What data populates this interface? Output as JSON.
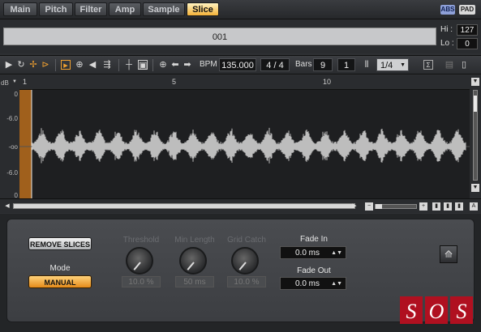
{
  "tabs": [
    {
      "label": "Main",
      "active": false
    },
    {
      "label": "Pitch",
      "active": false
    },
    {
      "label": "Filter",
      "active": false
    },
    {
      "label": "Amp",
      "active": false
    },
    {
      "label": "Sample",
      "active": false
    },
    {
      "label": "Slice",
      "active": true
    }
  ],
  "header_badges": {
    "abs": "ABS",
    "pad": "PAD"
  },
  "slice": {
    "name": "001",
    "hi_label": "Hi :",
    "hi_value": "127",
    "lo_label": "Lo :",
    "lo_value": "0"
  },
  "toolbar": {
    "bpm_label": "BPM",
    "bpm_value": "135.000",
    "time_signature": "4 / 4",
    "bars_label": "Bars",
    "bars_value": "9",
    "beats_value": "1",
    "grid_value": "1/4",
    "icons": [
      "play-icon",
      "loop-icon",
      "slice-marker-icon",
      "snap-icon",
      "select-icon",
      "zoom-icon",
      "speaker-icon",
      "sweep-icon",
      "marker-icon",
      "lock-icon",
      "zoom-tool-icon",
      "left-arrow-icon",
      "right-arrow-icon",
      "grid-icon",
      "menu-icon",
      "dropdown-icon"
    ]
  },
  "waveform": {
    "db_unit": "dB",
    "db_labels": [
      "0",
      "-6.0",
      "-oo",
      "-6.0",
      "0"
    ],
    "ruler_marks": [
      "1",
      "5",
      "10"
    ]
  },
  "slice_panel": {
    "remove_slices_label": "REMOVE SLICES",
    "mode_label": "Mode",
    "mode_value": "MANUAL",
    "threshold_label": "Threshold",
    "threshold_value": "10.0 %",
    "min_length_label": "Min Length",
    "min_length_value": "50 ms",
    "grid_catch_label": "Grid Catch",
    "grid_catch_value": "10.0 %",
    "fade_in_label": "Fade In",
    "fade_in_value": "0.0 ms",
    "fade_out_label": "Fade Out",
    "fade_out_value": "0.0 ms"
  },
  "watermark": {
    "text": "SOS"
  },
  "colors": {
    "accent": "#f0a030",
    "waveform": "#bdbdbd",
    "slice_region": "#a0601c"
  }
}
